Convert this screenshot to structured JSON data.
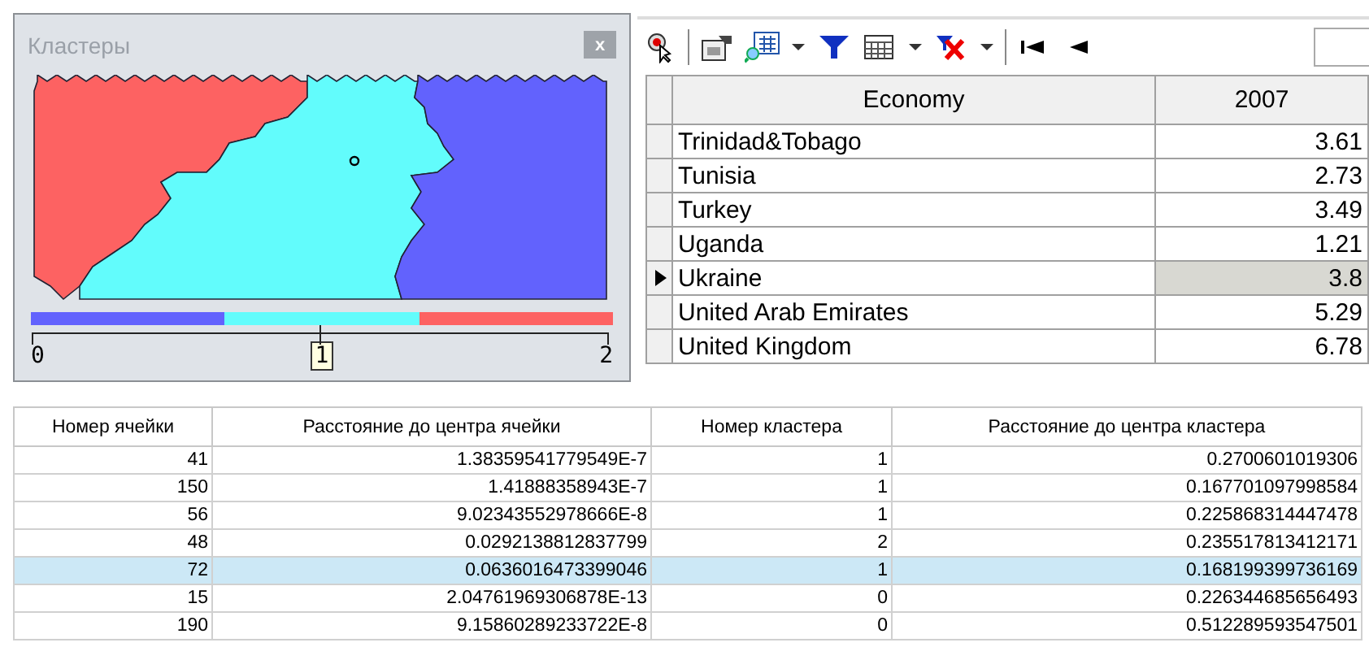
{
  "cluster_panel": {
    "title": "Кластеры",
    "close": "x",
    "legend": [
      {
        "color": "#6262fd"
      },
      {
        "color": "#62fcfc"
      },
      {
        "color": "#fd6262"
      }
    ],
    "axis_labels": [
      {
        "text": "0",
        "selected": false
      },
      {
        "text": "1",
        "selected": true
      },
      {
        "text": "2",
        "selected": false
      }
    ]
  },
  "toolbar": {
    "items": [
      {
        "kind": "pointer"
      },
      {
        "kind": "sep"
      },
      {
        "kind": "properties"
      },
      {
        "kind": "grid-search"
      },
      {
        "kind": "dropdown"
      },
      {
        "kind": "filter"
      },
      {
        "kind": "table"
      },
      {
        "kind": "dropdown"
      },
      {
        "kind": "clear-filter"
      },
      {
        "kind": "dropdown"
      },
      {
        "kind": "sep"
      },
      {
        "kind": "first"
      },
      {
        "kind": "prev"
      },
      {
        "kind": "field"
      }
    ]
  },
  "data_grid": {
    "columns": [
      "Economy",
      "2007"
    ],
    "rows": [
      {
        "cells": [
          "Trinidad&Tobago",
          "3.61"
        ],
        "current": false
      },
      {
        "cells": [
          "Tunisia",
          "2.73"
        ],
        "current": false
      },
      {
        "cells": [
          "Turkey",
          "3.49"
        ],
        "current": false
      },
      {
        "cells": [
          "Uganda",
          "1.21"
        ],
        "current": false
      },
      {
        "cells": [
          "Ukraine",
          "3.8"
        ],
        "current": true
      },
      {
        "cells": [
          "United Arab Emirates",
          "5.29"
        ],
        "current": false
      },
      {
        "cells": [
          "United Kingdom",
          "6.78"
        ],
        "current": false
      }
    ]
  },
  "cells_table": {
    "columns": [
      "Номер ячейки",
      "Расстояние до центра ячейки",
      "Номер кластера",
      "Расстояние до центра кластера"
    ],
    "rows": [
      {
        "cells": [
          "41",
          "1.38359541779549E-7",
          "1",
          "0.2700601019306"
        ],
        "selected": false
      },
      {
        "cells": [
          "150",
          "1.41888358943E-7",
          "1",
          "0.167701097998584"
        ],
        "selected": false
      },
      {
        "cells": [
          "56",
          "9.02343552978666E-8",
          "1",
          "0.225868314447478"
        ],
        "selected": false
      },
      {
        "cells": [
          "48",
          "0.0292138812837799",
          "2",
          "0.235517813412171"
        ],
        "selected": false
      },
      {
        "cells": [
          "72",
          "0.0636016473399046",
          "1",
          "0.168199399736169"
        ],
        "selected": true
      },
      {
        "cells": [
          "15",
          "2.04761969306878E-13",
          "0",
          "0.226344685656493"
        ],
        "selected": false
      },
      {
        "cells": [
          "190",
          "9.15860289233722E-8",
          "0",
          "0.512289593547501"
        ],
        "selected": false
      }
    ]
  }
}
